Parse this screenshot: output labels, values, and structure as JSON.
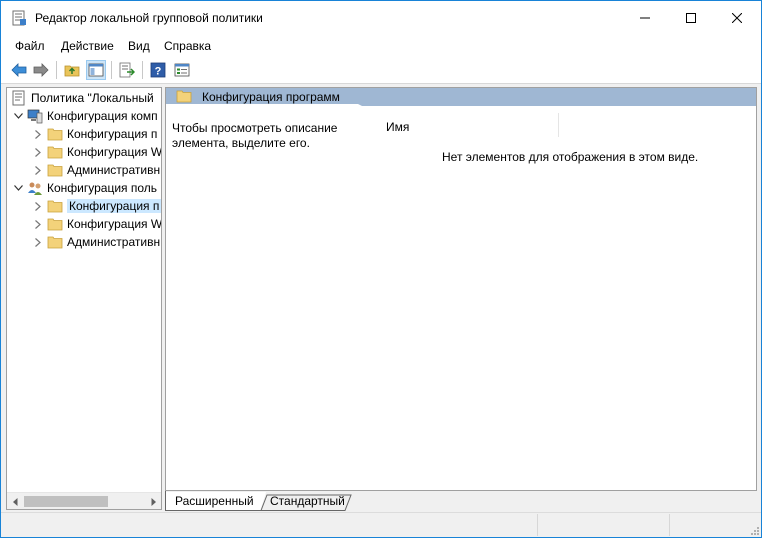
{
  "window": {
    "title": "Редактор локальной групповой политики",
    "accent": "#1883d7"
  },
  "menu": {
    "items": [
      "Файл",
      "Действие",
      "Вид",
      "Справка"
    ]
  },
  "toolbar": {
    "buttons": [
      "back-arrow-icon",
      "forward-arrow-icon",
      "up-folder-icon",
      "show-hide-tree-icon",
      "export-list-icon",
      "help-icon",
      "properties-view-icon"
    ]
  },
  "tree": {
    "root": "Политика \"Локальный",
    "computer_config": "Конфигурация комп",
    "computer_children": [
      "Конфигурация п",
      "Конфигурация W",
      "Административн"
    ],
    "user_config": "Конфигурация поль",
    "user_children": [
      "Конфигурация п",
      "Конфигурация W",
      "Административн"
    ]
  },
  "right_pane": {
    "header_title": "Конфигурация программ",
    "description": "Чтобы просмотреть описание элемента, выделите его.",
    "column_name": "Имя",
    "empty_message": "Нет элементов для отображения в этом виде.",
    "header_color": "#9fb7d3"
  },
  "tabs": {
    "extended": "Расширенный",
    "standard": "Стандартный"
  }
}
